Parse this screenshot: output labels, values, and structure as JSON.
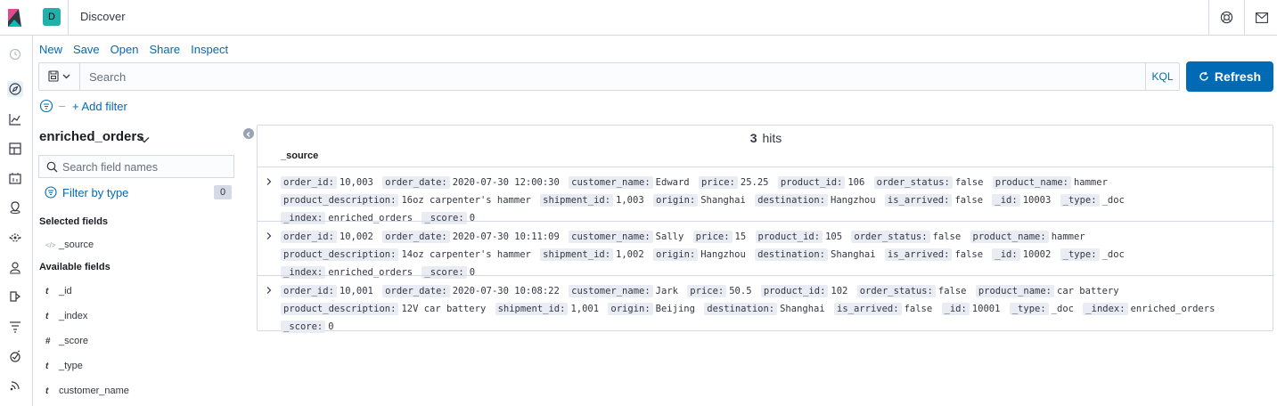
{
  "app": {
    "space_initial": "D",
    "title": "Discover"
  },
  "menu": {
    "items": [
      "New",
      "Save",
      "Open",
      "Share",
      "Inspect"
    ]
  },
  "query": {
    "placeholder": "Search",
    "language": "KQL",
    "refresh_label": "Refresh"
  },
  "filters": {
    "add_filter_label": "+ Add filter"
  },
  "sidebar": {
    "index_pattern": "enriched_orders",
    "search_placeholder": "Search field names",
    "filter_by_type_label": "Filter by type",
    "filter_count": "0",
    "selected_fields_title": "Selected fields",
    "selected_fields": [
      {
        "type": "</>",
        "name": "_source"
      }
    ],
    "available_fields_title": "Available fields",
    "available_fields": [
      {
        "type": "t",
        "name": "_id"
      },
      {
        "type": "t",
        "name": "_index"
      },
      {
        "type": "#",
        "name": "_score"
      },
      {
        "type": "t",
        "name": "_type"
      },
      {
        "type": "t",
        "name": "customer_name"
      }
    ]
  },
  "results": {
    "hits_count": "3",
    "hits_label": "hits",
    "column_header": "_source",
    "rows": [
      {
        "fields": [
          [
            "order_id:",
            "10,003"
          ],
          [
            "order_date:",
            "2020-07-30 12:00:30"
          ],
          [
            "customer_name:",
            "Edward"
          ],
          [
            "price:",
            "25.25"
          ],
          [
            "product_id:",
            "106"
          ],
          [
            "order_status:",
            "false"
          ],
          [
            "product_name:",
            "hammer"
          ],
          [
            "product_description:",
            "16oz carpenter's hammer"
          ],
          [
            "shipment_id:",
            "1,003"
          ],
          [
            "origin:",
            "Shanghai"
          ],
          [
            "destination:",
            "Hangzhou"
          ],
          [
            "is_arrived:",
            "false"
          ],
          [
            "_id:",
            "10003"
          ],
          [
            "_type:",
            "_doc"
          ],
          [
            "_index:",
            "enriched_orders"
          ],
          [
            "_score:",
            "0"
          ]
        ]
      },
      {
        "fields": [
          [
            "order_id:",
            "10,002"
          ],
          [
            "order_date:",
            "2020-07-30 10:11:09"
          ],
          [
            "customer_name:",
            "Sally"
          ],
          [
            "price:",
            "15"
          ],
          [
            "product_id:",
            "105"
          ],
          [
            "order_status:",
            "false"
          ],
          [
            "product_name:",
            "hammer"
          ],
          [
            "product_description:",
            "14oz carpenter's hammer"
          ],
          [
            "shipment_id:",
            "1,002"
          ],
          [
            "origin:",
            "Hangzhou"
          ],
          [
            "destination:",
            "Shanghai"
          ],
          [
            "is_arrived:",
            "false"
          ],
          [
            "_id:",
            "10002"
          ],
          [
            "_type:",
            "_doc"
          ],
          [
            "_index:",
            "enriched_orders"
          ],
          [
            "_score:",
            "0"
          ]
        ]
      },
      {
        "fields": [
          [
            "order_id:",
            "10,001"
          ],
          [
            "order_date:",
            "2020-07-30 10:08:22"
          ],
          [
            "customer_name:",
            "Jark"
          ],
          [
            "price:",
            "50.5"
          ],
          [
            "product_id:",
            "102"
          ],
          [
            "order_status:",
            "false"
          ],
          [
            "product_name:",
            "car battery"
          ],
          [
            "product_description:",
            "12V car battery"
          ],
          [
            "shipment_id:",
            "1,001"
          ],
          [
            "origin:",
            "Beijing"
          ],
          [
            "destination:",
            "Shanghai"
          ],
          [
            "is_arrived:",
            "false"
          ],
          [
            "_id:",
            "10001"
          ],
          [
            "_type:",
            "_doc"
          ],
          [
            "_index:",
            "enriched_orders"
          ],
          [
            "_score:",
            "0"
          ]
        ]
      }
    ]
  },
  "colors": {
    "accent": "#006bb4",
    "space_avatar": "#20b2aa",
    "border": "#d3dae6"
  },
  "icons": {
    "logo": "kibana-logo-icon",
    "help": "help-icon",
    "mail": "mail-icon",
    "nav": [
      "clock-icon",
      "discover-icon",
      "visualize-icon",
      "dashboard-icon",
      "canvas-icon",
      "maps-icon",
      "ml-icon",
      "siem-icon",
      "logs-icon",
      "apm-icon",
      "uptime-icon",
      "signal-icon"
    ]
  }
}
